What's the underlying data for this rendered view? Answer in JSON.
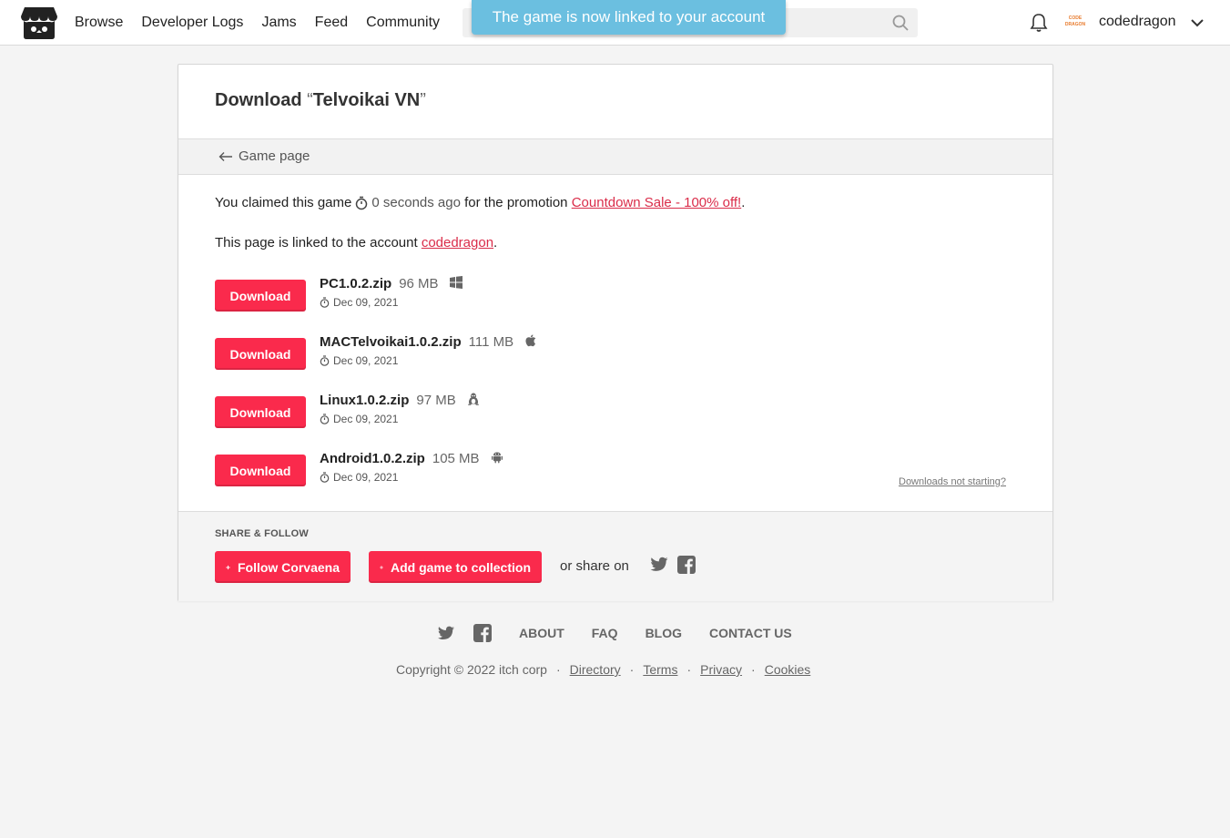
{
  "header": {
    "nav": [
      "Browse",
      "Developer Logs",
      "Jams",
      "Feed",
      "Community"
    ],
    "toast": "The game is now linked to your account",
    "avatar_text": "CODE DRAGON",
    "username": "codedragon"
  },
  "page": {
    "title_prefix": "Download ",
    "title_open_quote": "“",
    "title_game": "Telvoikai VN",
    "title_close_quote": "”",
    "back_label": "Game page",
    "claim_prefix": "You claimed this game",
    "claim_time": "0 seconds ago",
    "claim_middle": "for the promotion",
    "promotion": "Countdown Sale - 100% off!",
    "claim_end": ".",
    "linked_prefix": "This page is linked to the account",
    "linked_account": "codedragon",
    "linked_end": ".",
    "download_label": "Download",
    "not_starting": "Downloads not starting?"
  },
  "uploads": [
    {
      "name": "PC1.0.2.zip",
      "size": "96 MB",
      "platform": "windows-icon",
      "date": "Dec 09, 2021"
    },
    {
      "name": "MACTelvoikai1.0.2.zip",
      "size": "111 MB",
      "platform": "apple-icon",
      "date": "Dec 09, 2021"
    },
    {
      "name": "Linux1.0.2.zip",
      "size": "97 MB",
      "platform": "linux-icon",
      "date": "Dec 09, 2021"
    },
    {
      "name": "Android1.0.2.zip",
      "size": "105 MB",
      "platform": "android-icon",
      "date": "Dec 09, 2021"
    }
  ],
  "share": {
    "label": "SHARE & FOLLOW",
    "follow": "Follow Corvaena",
    "collection": "Add game to collection",
    "or_share": "or share on"
  },
  "footer": {
    "links": [
      "ABOUT",
      "FAQ",
      "BLOG",
      "CONTACT US"
    ],
    "copyright": "Copyright © 2022 itch corp",
    "sep": "·",
    "legal": [
      "Directory",
      "Terms",
      "Privacy",
      "Cookies"
    ]
  },
  "colors": {
    "accent": "#fa2a4c",
    "link": "#da2c49",
    "toast": "#6bbfe0"
  }
}
